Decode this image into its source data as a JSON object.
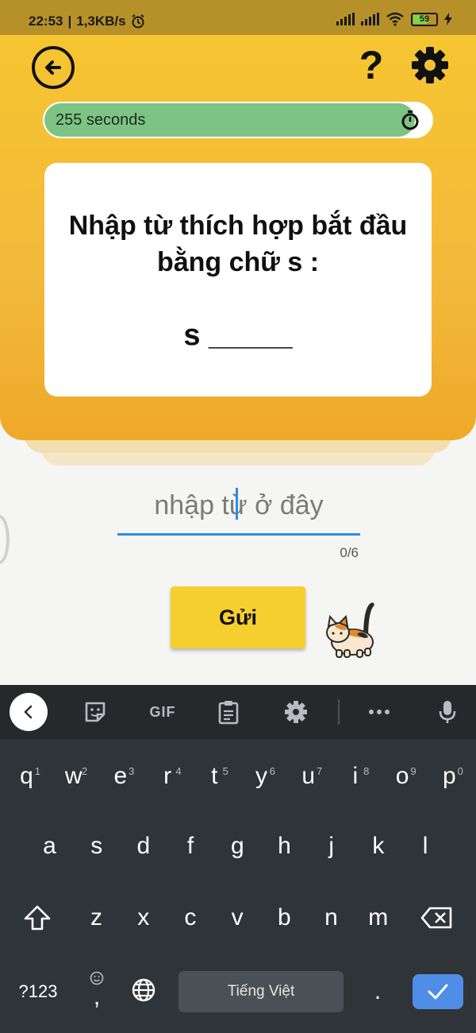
{
  "status_bar": {
    "time": "22:53",
    "speed": "1,3KB/s",
    "battery": "59",
    "icons": [
      "alarm-icon",
      "signal-icon",
      "signal-icon",
      "wifi-icon",
      "battery-icon",
      "charging-icon"
    ]
  },
  "header": {
    "back_icon": "arrow-left-circle-icon",
    "help_label": "?",
    "settings_icon": "gear-icon"
  },
  "timer": {
    "label": "255 seconds",
    "remaining_fraction": 0.95,
    "icon": "stopwatch-icon",
    "color": "#7dc383"
  },
  "question": {
    "prompt": "Nhập từ thích hợp bắt đầu bằng chữ s :",
    "blank": "s _____"
  },
  "answer": {
    "placeholder": "nhập từ ở đây",
    "value": "",
    "counter": "0/6"
  },
  "submit_label": "Gửi",
  "mascot": "cat-icon",
  "keyboard": {
    "toolbar_icons": [
      "chevron-left-icon",
      "sticker-icon",
      "gif-icon",
      "clipboard-icon",
      "gear-icon",
      "more-icon",
      "microphone-icon"
    ],
    "gif_label": "GIF",
    "row1": [
      {
        "k": "q",
        "h": "1"
      },
      {
        "k": "w",
        "h": "2"
      },
      {
        "k": "e",
        "h": "3"
      },
      {
        "k": "r",
        "h": "4"
      },
      {
        "k": "t",
        "h": "5"
      },
      {
        "k": "y",
        "h": "6"
      },
      {
        "k": "u",
        "h": "7"
      },
      {
        "k": "i",
        "h": "8"
      },
      {
        "k": "o",
        "h": "9"
      },
      {
        "k": "p",
        "h": "0"
      }
    ],
    "row2": [
      "a",
      "s",
      "d",
      "f",
      "g",
      "h",
      "j",
      "k",
      "l"
    ],
    "row3": [
      "z",
      "x",
      "c",
      "v",
      "b",
      "n",
      "m"
    ],
    "symbols_label": "?123",
    "comma_label": ",",
    "space_label": "Tiếng Việt",
    "period_label": ".",
    "accent": "#4f8de6"
  }
}
